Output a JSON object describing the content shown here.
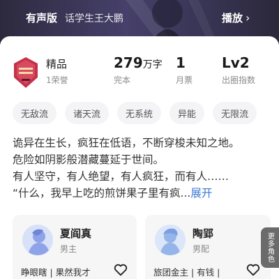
{
  "audio": {
    "label": "有声版",
    "narrator": "话学生王大鹏",
    "play_label": "播放"
  },
  "stats": {
    "quality": "精品",
    "honors": "1荣誉",
    "word_count": "279",
    "word_unit": "万字",
    "status": "完本",
    "monthly_votes": "1",
    "monthly_votes_label": "月票",
    "level": "Lv2",
    "level_label": "出圈指数"
  },
  "tags": [
    "无敌流",
    "诸天流",
    "无系统",
    "异能",
    "无限流"
  ],
  "synopsis": {
    "lines": [
      "诡异在生长，疯狂在低语，不断穿梭未知之地。",
      "危险如阴影般潜藏蔓延于世间。",
      "有人坚守，有人绝望，有人疯狂，而有人……",
      "“什么，我早上吃的煎饼果子里有疯..."
    ],
    "expand_label": "展开"
  },
  "characters": [
    {
      "name": "夏阎真",
      "role": "男主",
      "tags": "睁眼瞎 | 果然我才"
    },
    {
      "name": "陶郢",
      "role": "男配",
      "tags": "旅团金主 | 有钱 |"
    }
  ],
  "more_roles_label": "更多角色",
  "colors": {
    "accent": "#3a78d6",
    "tag_bg": "#f4f4f6",
    "card_bg": "#f6f6f7",
    "banner_bg": "#3a3657"
  }
}
